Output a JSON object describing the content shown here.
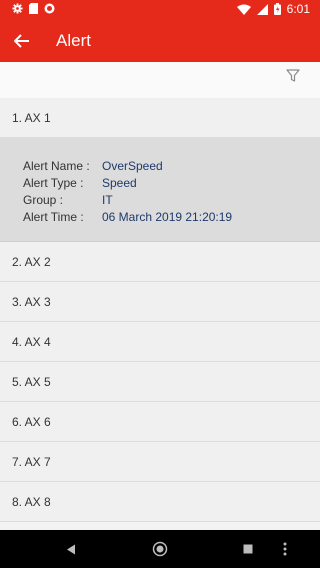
{
  "status": {
    "time": "6:01"
  },
  "appbar": {
    "title": "Alert"
  },
  "list": {
    "items": [
      {
        "label": "1. AX 1"
      },
      {
        "label": "2. AX 2"
      },
      {
        "label": "3. AX 3"
      },
      {
        "label": "4. AX 4"
      },
      {
        "label": "5. AX 5"
      },
      {
        "label": "6. AX 6"
      },
      {
        "label": "7. AX 7"
      },
      {
        "label": "8. AX 8"
      }
    ],
    "detail": {
      "alert_name_label": "Alert Name :",
      "alert_name_value": "OverSpeed",
      "alert_type_label": "Alert Type :",
      "alert_type_value": "Speed",
      "group_label": "Group :",
      "group_value": "IT",
      "alert_time_label": "Alert Time :",
      "alert_time_value": "06 March 2019 21:20:19"
    }
  },
  "colors": {
    "accent": "#e5291b",
    "value_text": "#1d3a6b"
  }
}
